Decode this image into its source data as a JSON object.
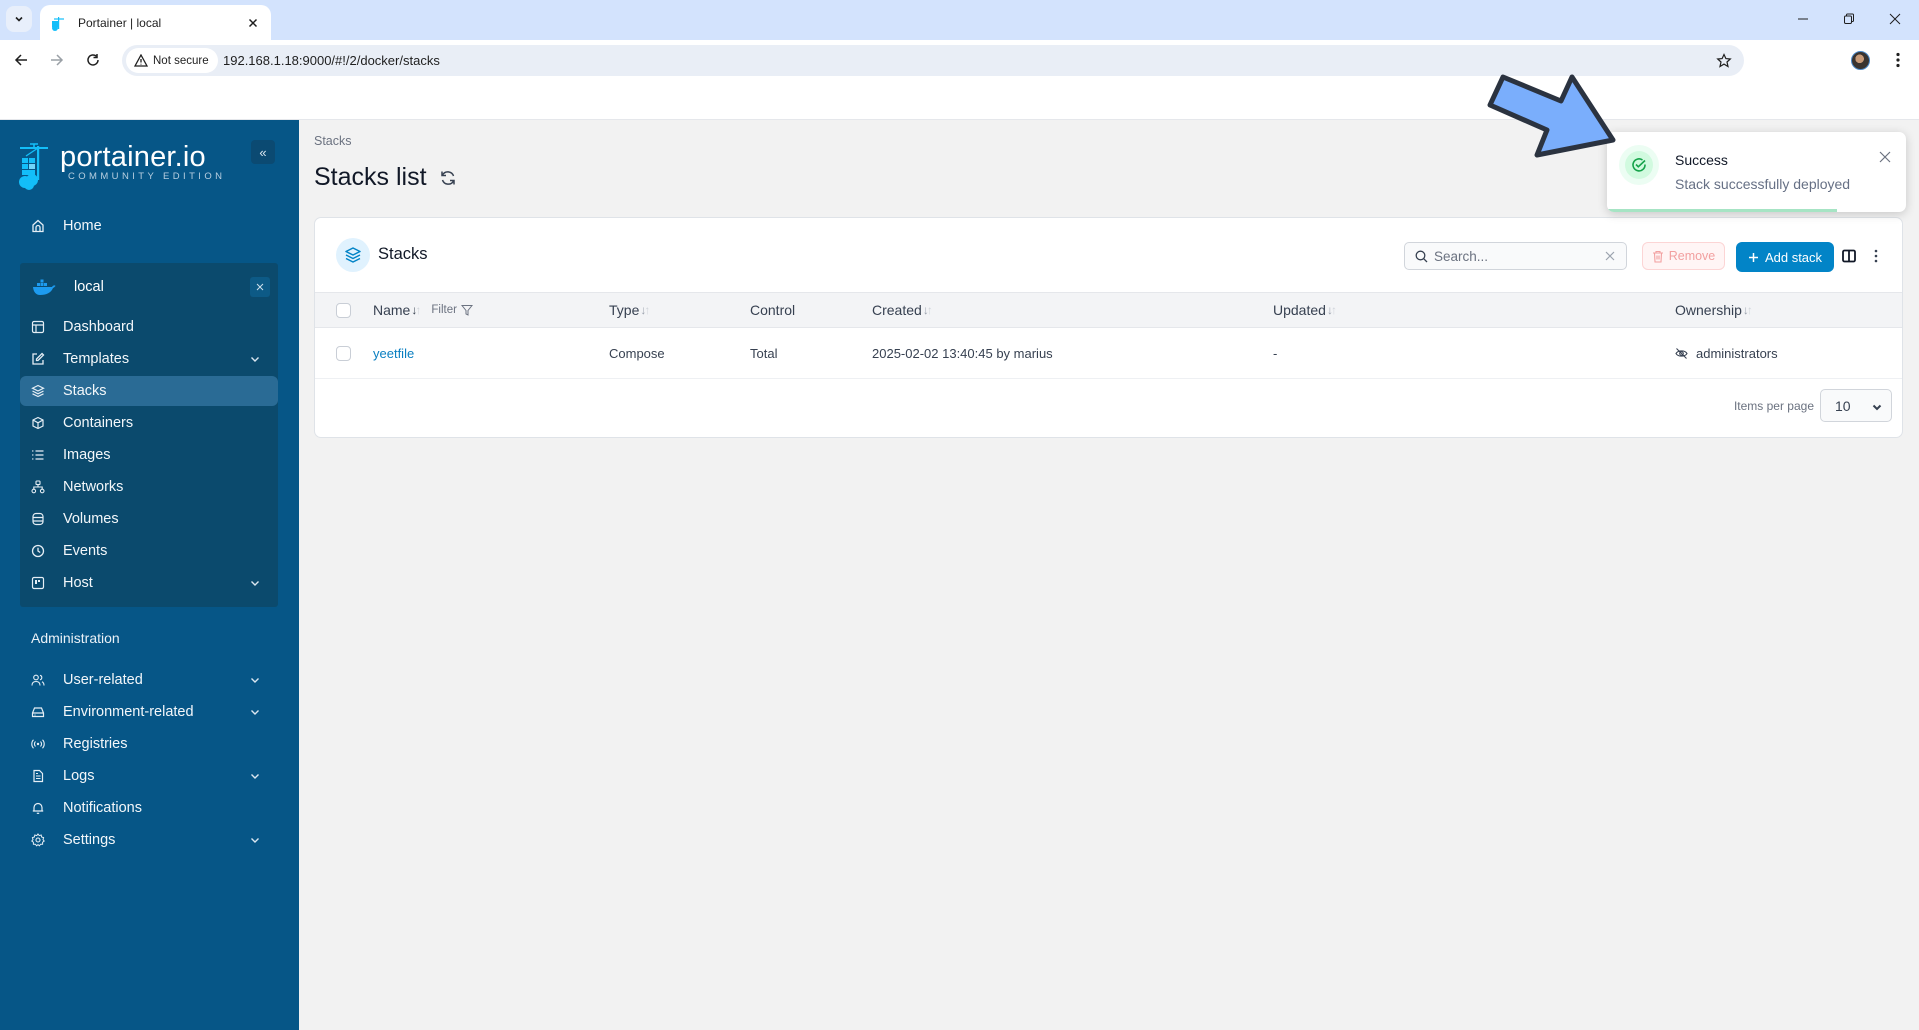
{
  "browser": {
    "tab_title": "Portainer | local",
    "not_secure_label": "Not secure",
    "url": "192.168.1.18:9000/#!/2/docker/stacks"
  },
  "sidebar": {
    "logo_name": "portainer.io",
    "logo_edition": "COMMUNITY EDITION",
    "collapse_label": "«",
    "home": {
      "label": "Home",
      "icon": "home-icon"
    },
    "environment": {
      "name": "local",
      "icon": "docker-icon",
      "items": [
        {
          "label": "Dashboard",
          "icon": "dashboard-icon",
          "expandable": false,
          "active": false
        },
        {
          "label": "Templates",
          "icon": "edit-icon",
          "expandable": true,
          "active": false
        },
        {
          "label": "Stacks",
          "icon": "layers-icon",
          "expandable": false,
          "active": true
        },
        {
          "label": "Containers",
          "icon": "box-icon",
          "expandable": false,
          "active": false
        },
        {
          "label": "Images",
          "icon": "list-icon",
          "expandable": false,
          "active": false
        },
        {
          "label": "Networks",
          "icon": "network-icon",
          "expandable": false,
          "active": false
        },
        {
          "label": "Volumes",
          "icon": "database-icon",
          "expandable": false,
          "active": false
        },
        {
          "label": "Events",
          "icon": "clock-icon",
          "expandable": false,
          "active": false
        },
        {
          "label": "Host",
          "icon": "host-icon",
          "expandable": true,
          "active": false
        }
      ]
    },
    "admin_title": "Administration",
    "admin_items": [
      {
        "label": "User-related",
        "icon": "users-icon",
        "expandable": true
      },
      {
        "label": "Environment-related",
        "icon": "drive-icon",
        "expandable": true
      },
      {
        "label": "Registries",
        "icon": "radio-icon",
        "expandable": false
      },
      {
        "label": "Logs",
        "icon": "file-icon",
        "expandable": true
      },
      {
        "label": "Notifications",
        "icon": "bell-icon",
        "expandable": false
      },
      {
        "label": "Settings",
        "icon": "gear-icon",
        "expandable": true
      }
    ]
  },
  "main": {
    "breadcrumb": "Stacks",
    "title": "Stacks list",
    "card": {
      "title": "Stacks",
      "search_placeholder": "Search...",
      "search_value": "",
      "remove_label": "Remove",
      "add_label": "Add stack",
      "columns": [
        {
          "label": "Name",
          "sortable": true,
          "sorted": "desc"
        },
        {
          "label": "Type",
          "sortable": true
        },
        {
          "label": "Control",
          "sortable": false
        },
        {
          "label": "Created",
          "sortable": true
        },
        {
          "label": "Updated",
          "sortable": true
        },
        {
          "label": "Ownership",
          "sortable": true
        }
      ],
      "filter_label": "Filter",
      "rows": [
        {
          "name": "yeetfile",
          "type": "Compose",
          "control": "Total",
          "created": "2025-02-02 13:40:45 by marius",
          "updated": "-",
          "ownership": "administrators"
        }
      ],
      "items_per_page_label": "Items per page",
      "items_per_page": "10"
    }
  },
  "toast": {
    "title": "Success",
    "message": "Stack successfully deployed",
    "progress_fraction": 0.77,
    "color": "#a6e4c4"
  },
  "colors": {
    "sidebar_bg": "#065687",
    "accent": "#0284c7",
    "annotation_arrow": "#7aaefc"
  }
}
